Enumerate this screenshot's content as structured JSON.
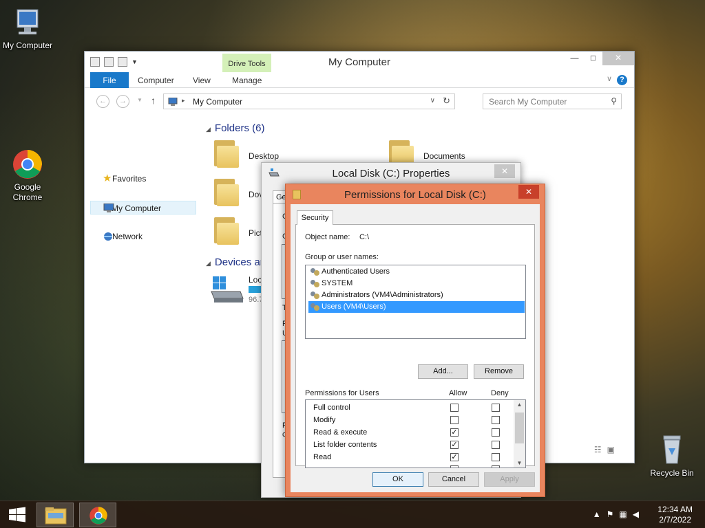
{
  "desktop": {
    "icons": [
      {
        "label": "My Computer"
      },
      {
        "label": "Google Chrome"
      },
      {
        "label": "Recycle Bin"
      }
    ]
  },
  "explorer": {
    "title": "My Computer",
    "contextual_tab": "Drive Tools",
    "ribbon_tabs": [
      "File",
      "Computer",
      "View",
      "Manage"
    ],
    "address": "My Computer",
    "search_placeholder": "Search My Computer",
    "nav": [
      {
        "label": "Favorites",
        "icon": "star-icon"
      },
      {
        "label": "My Computer",
        "icon": "computer-icon",
        "selected": true
      },
      {
        "label": "Network",
        "icon": "network-icon"
      }
    ],
    "folders_header": "Folders (6)",
    "folders": [
      {
        "name": "Desktop"
      },
      {
        "name": "Documents"
      },
      {
        "name": "Dov"
      },
      {
        "name": "Pict"
      }
    ],
    "devices_header": "Devices ar",
    "drive": {
      "name": "Loc",
      "free": "96.7"
    }
  },
  "properties_dialog": {
    "title": "Local Disk (C:) Properties",
    "tab_fragment": "Ge",
    "fragments": [
      "C",
      "G",
      "T",
      "F",
      "U",
      "F",
      "c"
    ]
  },
  "permissions_dialog": {
    "title": "Permissions for Local Disk (C:)",
    "tab": "Security",
    "object_label": "Object name:",
    "object_value": "C:\\",
    "group_label": "Group or user names:",
    "users": [
      {
        "name": "Authenticated Users"
      },
      {
        "name": "SYSTEM"
      },
      {
        "name": "Administrators (VM4\\Administrators)"
      },
      {
        "name": "Users (VM4\\Users)",
        "selected": true
      }
    ],
    "add_button": "Add...",
    "remove_button": "Remove",
    "perms_label": "Permissions for Users",
    "allow_label": "Allow",
    "deny_label": "Deny",
    "permissions": [
      {
        "name": "Full control",
        "allow": false,
        "deny": false
      },
      {
        "name": "Modify",
        "allow": false,
        "deny": false
      },
      {
        "name": "Read & execute",
        "allow": true,
        "deny": false
      },
      {
        "name": "List folder contents",
        "allow": true,
        "deny": false
      },
      {
        "name": "Read",
        "allow": true,
        "deny": false
      }
    ],
    "ok": "OK",
    "cancel": "Cancel",
    "apply": "Apply"
  },
  "taskbar": {
    "time": "12:34 AM",
    "date": "2/7/2022"
  }
}
